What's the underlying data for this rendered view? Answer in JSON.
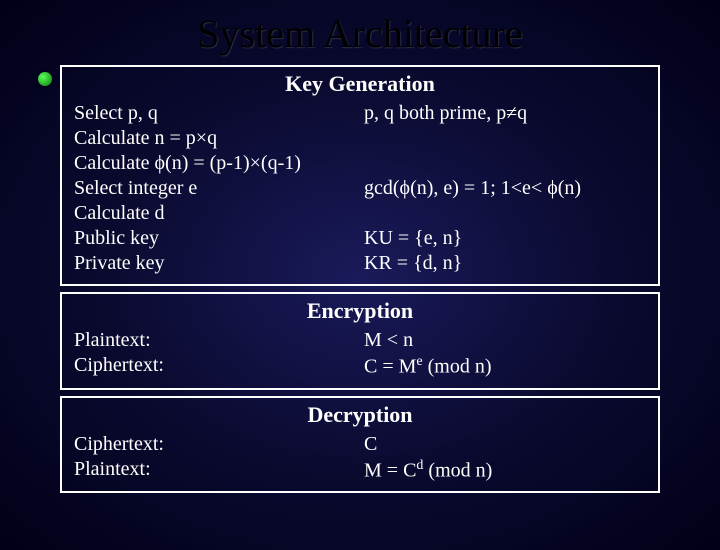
{
  "title": "System Architecture",
  "keygen": {
    "heading": "Key Generation",
    "rows": [
      {
        "left": "Select p, q",
        "right": "p, q both prime, p≠q"
      },
      {
        "left": "Calculate n = p×q",
        "right": ""
      },
      {
        "left": "Calculate ϕ(n) = (p-1)×(q-1)",
        "right": ""
      },
      {
        "left": "Select integer e",
        "right": "gcd(ϕ(n), e) = 1; 1<e< ϕ(n)"
      },
      {
        "left": "Calculate d",
        "right": ""
      },
      {
        "left": "Public key",
        "right": "KU = {e, n}"
      },
      {
        "left": "Private key",
        "right": "KR = {d, n}"
      }
    ]
  },
  "encryption": {
    "heading": "Encryption",
    "rows": [
      {
        "left": "Plaintext:",
        "right": "M < n"
      },
      {
        "left": "Ciphertext:",
        "right_html": "C = M<sup>e</sup> (mod n)"
      }
    ]
  },
  "decryption": {
    "heading": "Decryption",
    "rows": [
      {
        "left": "Ciphertext:",
        "right": "C"
      },
      {
        "left": "Plaintext:",
        "right_html": "M = C<sup>d</sup> (mod n)"
      }
    ]
  }
}
